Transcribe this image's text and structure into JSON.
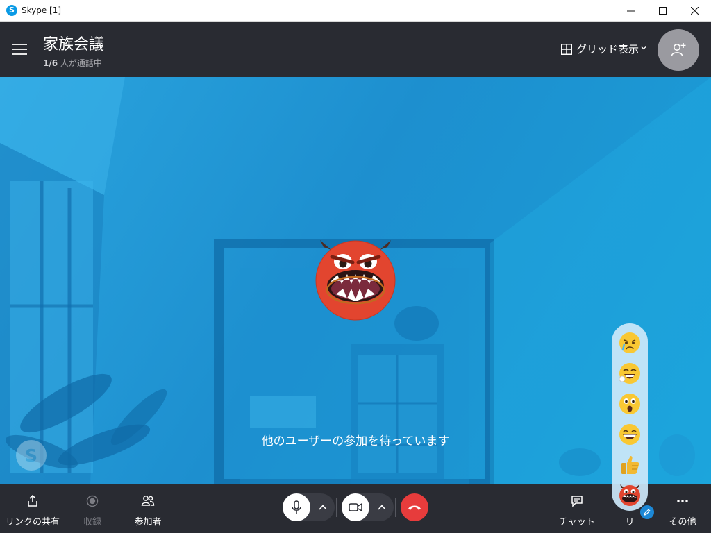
{
  "window": {
    "title": "Skype [1]",
    "app_icon_letter": "S"
  },
  "header": {
    "call_title": "家族会議",
    "participants_count": "1/6",
    "participants_suffix": " 人が通話中",
    "view_toggle_label": "グリッド表示"
  },
  "stage": {
    "waiting_message": "他のユーザーの参加を待っています",
    "avatar_emoticon": "devil-emoticon",
    "watermark": "skype-logo"
  },
  "reactions": [
    {
      "name": "crying-emoticon"
    },
    {
      "name": "laughing-emoticon"
    },
    {
      "name": "surprised-emoticon"
    },
    {
      "name": "grinning-emoticon"
    },
    {
      "name": "thumbs-up-emoticon"
    },
    {
      "name": "devil-emoticon"
    }
  ],
  "controls": {
    "share_link": "リンクの共有",
    "record": "収録",
    "participants": "参加者",
    "chat": "チャット",
    "reactions": "リ",
    "more": "その他"
  },
  "colors": {
    "header_bg": "#292b32",
    "stage_blue": "#1d8fcf",
    "hangup_red": "#e73c3c",
    "accent_blue": "#1c88d6"
  }
}
